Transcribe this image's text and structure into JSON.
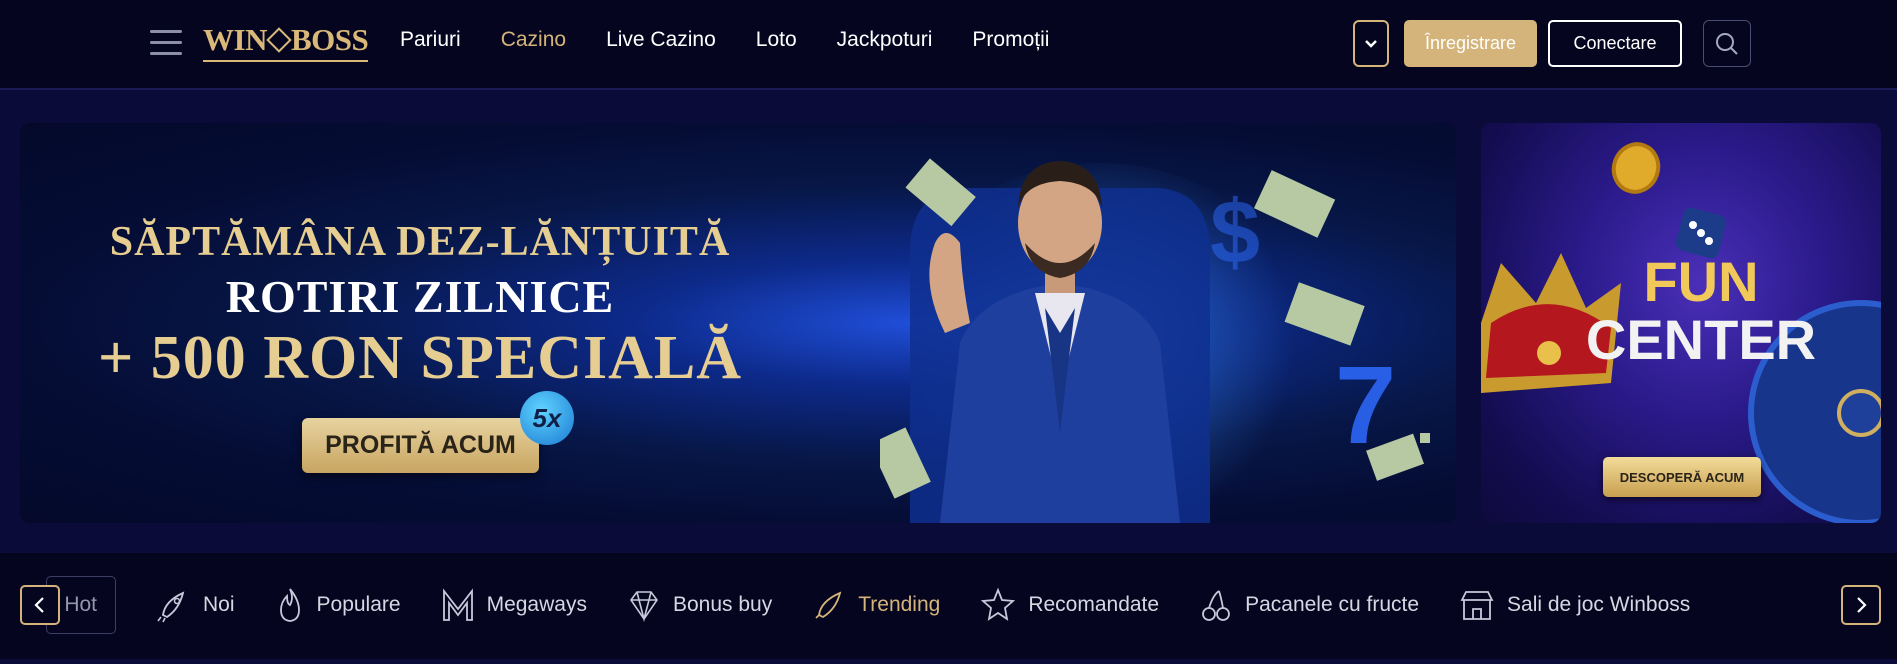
{
  "header": {
    "logo_text_left": "WIN",
    "logo_text_right": "BOSS",
    "nav": [
      {
        "label": "Pariuri",
        "active": false
      },
      {
        "label": "Cazino",
        "active": true
      },
      {
        "label": "Live Cazino",
        "active": false
      },
      {
        "label": "Loto",
        "active": false
      },
      {
        "label": "Jackpoturi",
        "active": false
      },
      {
        "label": "Promoții",
        "active": false
      }
    ],
    "register_label": "Înregistrare",
    "login_label": "Conectare"
  },
  "main_banner": {
    "line1": "SĂPTĂMÂNA DEZ-LĂNȚUITĂ",
    "line2": "ROTIRI ZILNICE",
    "line3": "+ 500 RON SPECIALĂ",
    "cta": "PROFITĂ ACUM",
    "badge": "5x"
  },
  "side_banner": {
    "title_line1": "FUN",
    "title_line2": "CENTER",
    "cta": "DESCOPERĂ ACUM"
  },
  "categories": {
    "partial_label": "Hot",
    "items": [
      {
        "label": "Noi",
        "icon": "rocket-icon"
      },
      {
        "label": "Populare",
        "icon": "flame-icon"
      },
      {
        "label": "Megaways",
        "icon": "megaways-m-icon"
      },
      {
        "label": "Bonus buy",
        "icon": "diamond-icon"
      },
      {
        "label": "Trending",
        "icon": "trending-rocket-icon"
      },
      {
        "label": "Recomandate",
        "icon": "star-icon"
      },
      {
        "label": "Pacanele cu fructe",
        "icon": "cherry-icon"
      },
      {
        "label": "Sali de joc Winboss",
        "icon": "store-icon"
      }
    ],
    "active_index": 4
  },
  "colors": {
    "gold": "#d4b47a",
    "header_bg": "#05051f",
    "page_bg": "#0b0b3a"
  }
}
